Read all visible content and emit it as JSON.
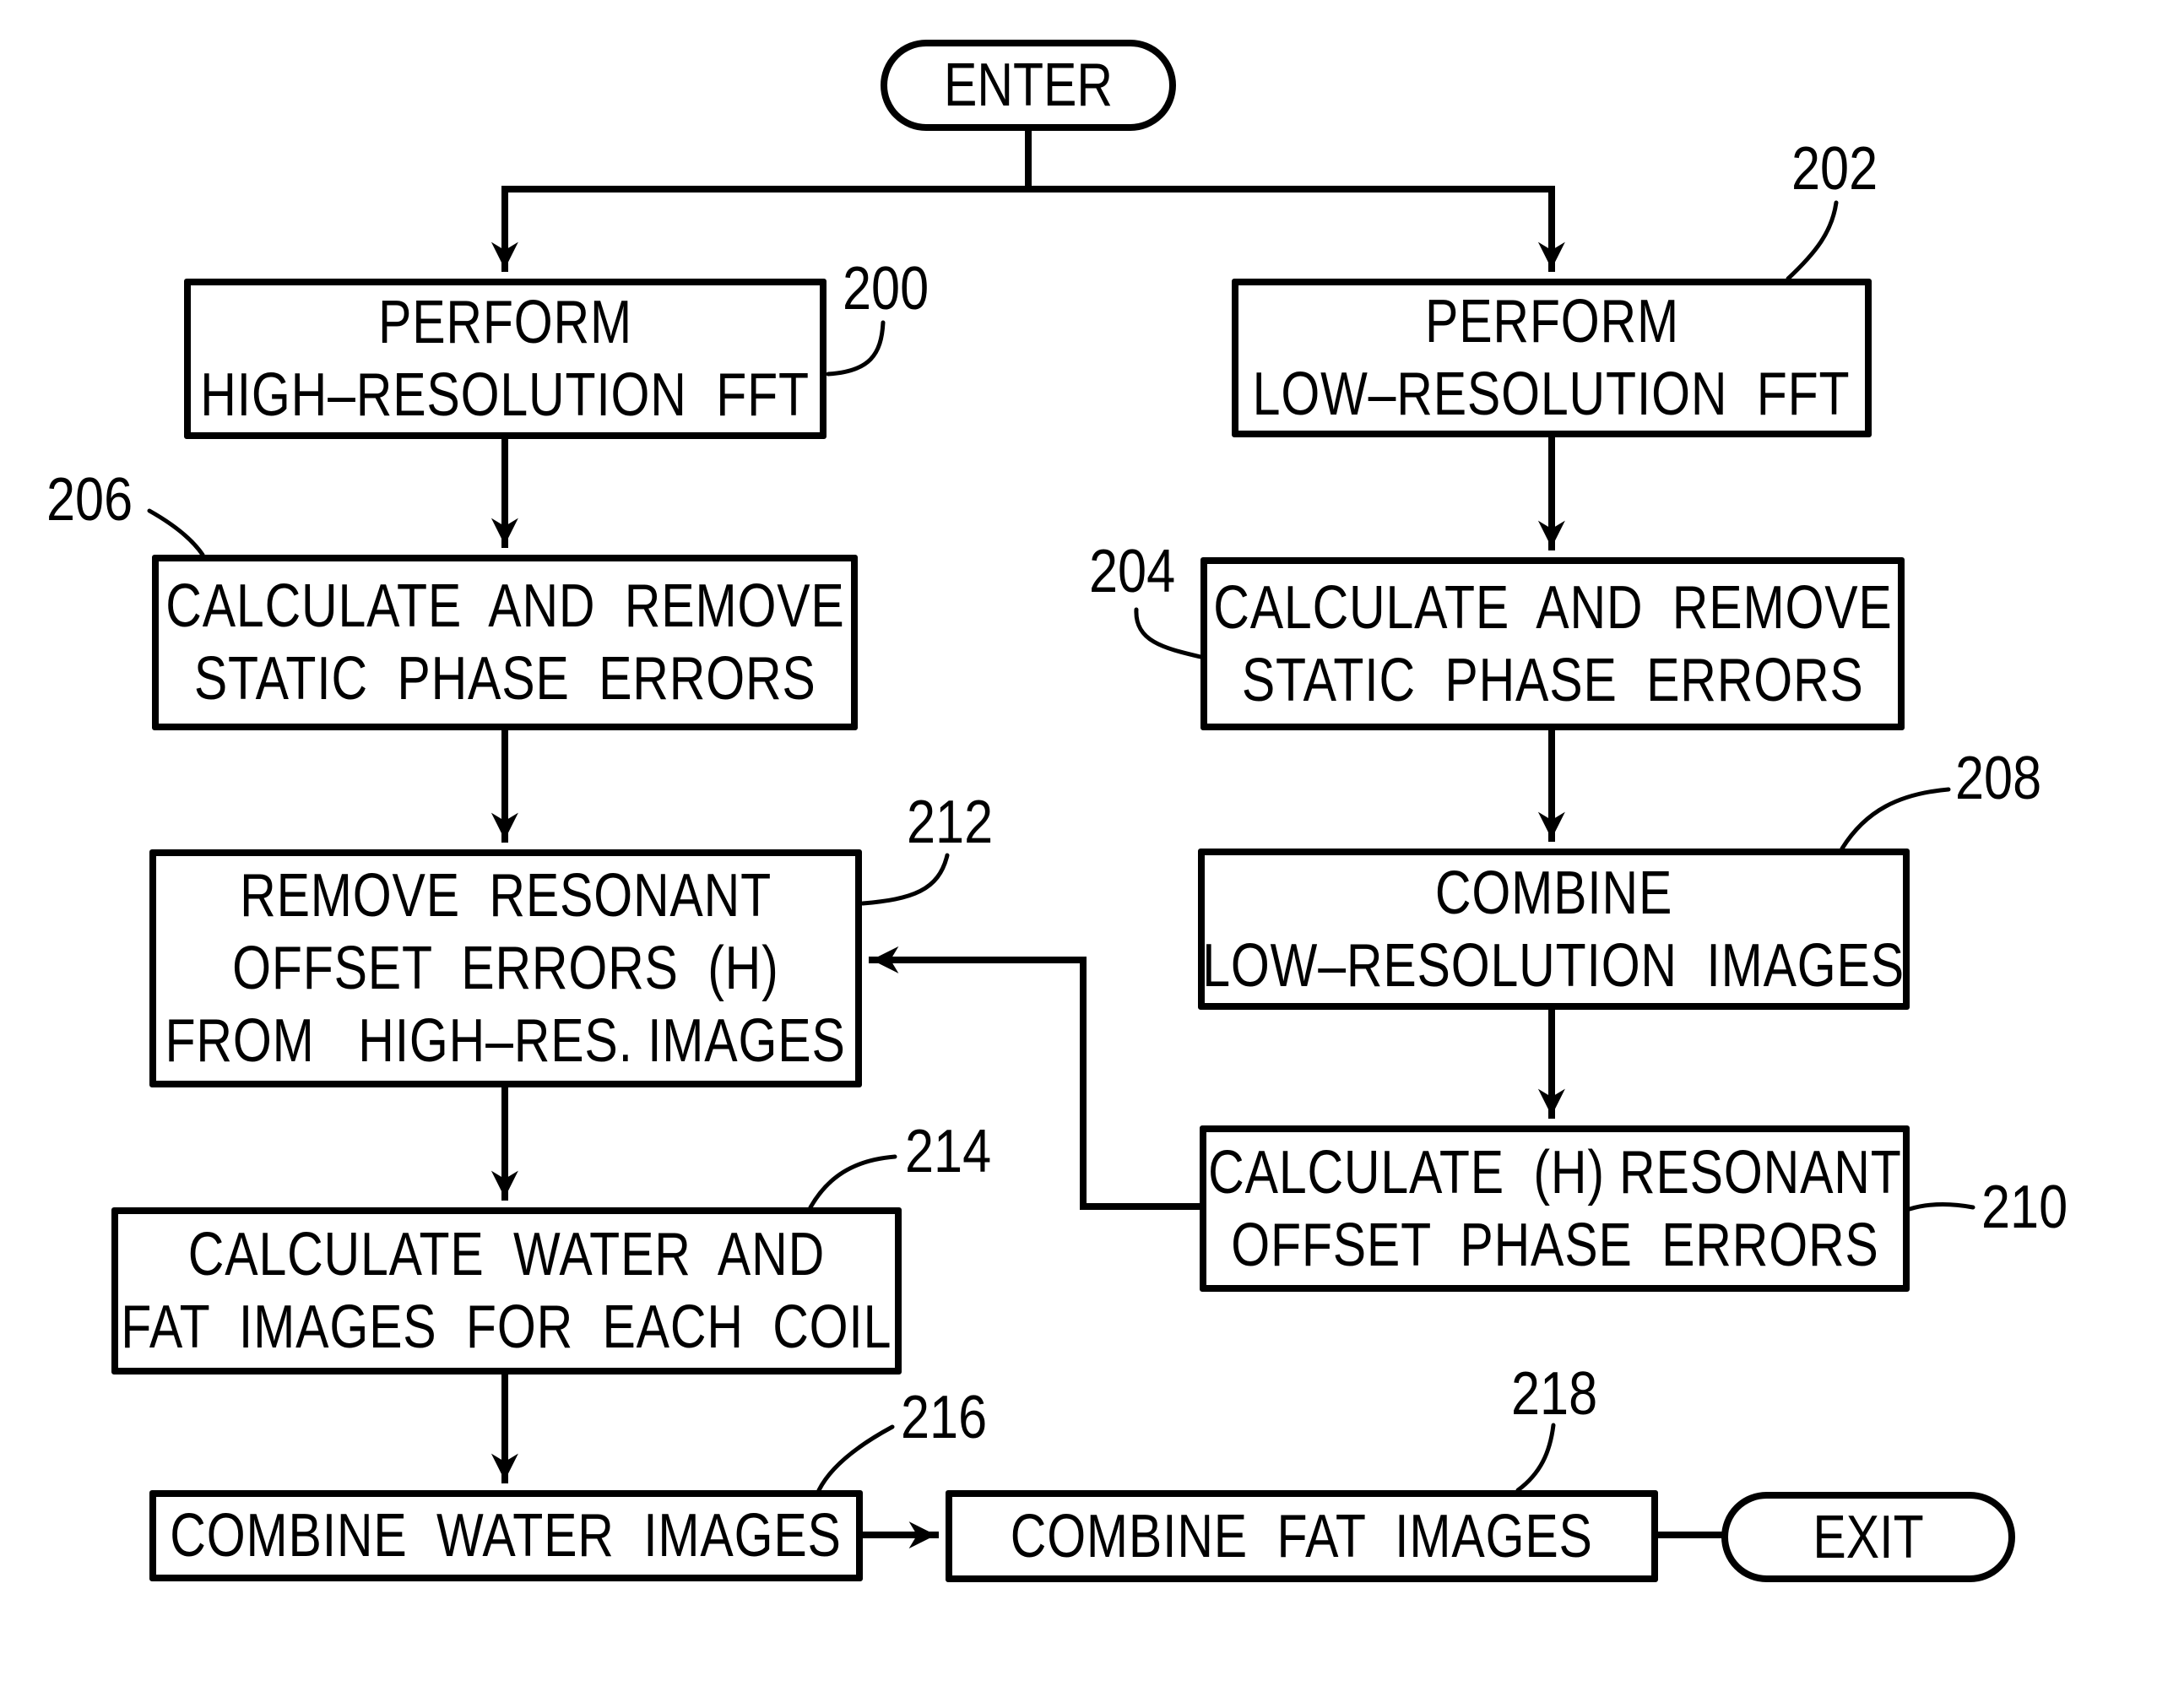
{
  "figure": {
    "start": {
      "label": "ENTER"
    },
    "end": {
      "label": "EXIT"
    },
    "steps": [
      {
        "ref": "200",
        "lines": [
          "PERFORM",
          "HIGH–RESOLUTION  FFT"
        ]
      },
      {
        "ref": "202",
        "lines": [
          "PERFORM",
          "LOW–RESOLUTION  FFT"
        ]
      },
      {
        "ref": "206",
        "lines": [
          "CALCULATE  AND  REMOVE",
          "STATIC  PHASE  ERRORS"
        ]
      },
      {
        "ref": "204",
        "lines": [
          "CALCULATE  AND  REMOVE",
          "STATIC  PHASE  ERRORS"
        ]
      },
      {
        "ref": "212",
        "lines": [
          "REMOVE  RESONANT",
          "OFFSET  ERRORS  (H)",
          "FROM   HIGH–RES. IMAGES"
        ]
      },
      {
        "ref": "208",
        "lines": [
          "COMBINE",
          "LOW–RESOLUTION  IMAGES"
        ]
      },
      {
        "ref": "210",
        "lines": [
          "CALCULATE  (H) RESONANT",
          "OFFSET  PHASE  ERRORS"
        ]
      },
      {
        "ref": "214",
        "lines": [
          "CALCULATE  WATER  AND",
          "FAT  IMAGES  FOR  EACH  COIL"
        ]
      },
      {
        "ref": "216",
        "lines": [
          "COMBINE  WATER  IMAGES"
        ]
      },
      {
        "ref": "218",
        "lines": [
          "COMBINE  FAT  IMAGES"
        ]
      }
    ]
  }
}
